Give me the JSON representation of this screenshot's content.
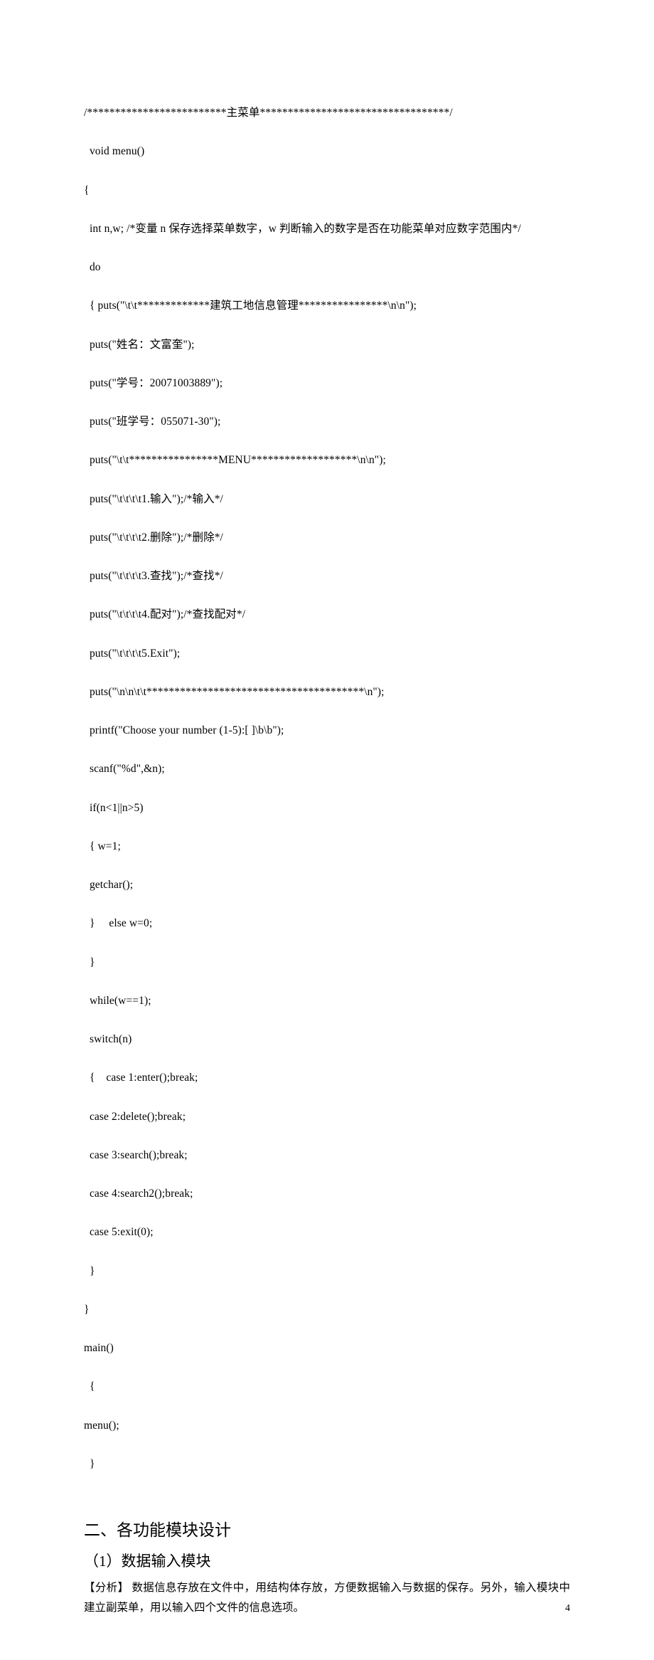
{
  "code": {
    "l00": "/*************************主菜单**********************************/",
    "l01": "  void menu()",
    "l02": "{",
    "l03": "  int n,w; /*变量 n 保存选择菜单数字，w 判断输入的数字是否在功能菜单对应数字范围内*/",
    "l04": "  do",
    "l05": "  { puts(\"\\t\\t*************建筑工地信息管理****************\\n\\n\");",
    "l06": "  puts(\"姓名：文富奎\");",
    "l07": "  puts(\"学号：20071003889\");",
    "l08": "  puts(\"班学号：055071-30\");",
    "l09": "  puts(\"\\t\\t****************MENU*******************\\n\\n\");",
    "l10": "  puts(\"\\t\\t\\t\\t1.输入\");/*输入*/",
    "l11": "  puts(\"\\t\\t\\t\\t2.删除\");/*删除*/",
    "l12": "  puts(\"\\t\\t\\t\\t3.查找\");/*查找*/",
    "l13": "  puts(\"\\t\\t\\t\\t4.配对\");/*查找配对*/",
    "l14": "  puts(\"\\t\\t\\t\\t5.Exit\");",
    "l15": "  puts(\"\\n\\n\\t\\t***************************************\\n\");",
    "l16": "  printf(\"Choose your number (1-5):[ ]\\b\\b\");",
    "l17": "  scanf(\"%d\",&n);",
    "l18": "  if(n<1||n>5)",
    "l19": "  { w=1;",
    "l20": "  getchar();",
    "l21": "  }     else w=0;",
    "l22": "  }",
    "l23": "  while(w==1);",
    "l24": "  switch(n)",
    "l25": "  {    case 1:enter();break;",
    "l26": "  case 2:delete();break;",
    "l27": "  case 3:search();break;",
    "l28": "  case 4:search2();break;",
    "l29": "  case 5:exit(0);",
    "l30": "  }",
    "l31": "}",
    "l32": "main()",
    "l33": "  {",
    "l34": "menu();",
    "l35": "  }"
  },
  "heading": "二、各功能模块设计",
  "subheading": "（1）数据输入模块",
  "paragraph": "【分析】  数据信息存放在文件中，用结构体存放，方便数据输入与数据的保存。另外，输入模块中建立副菜单，用以输入四个文件的信息选项。",
  "pageNumber": "4"
}
